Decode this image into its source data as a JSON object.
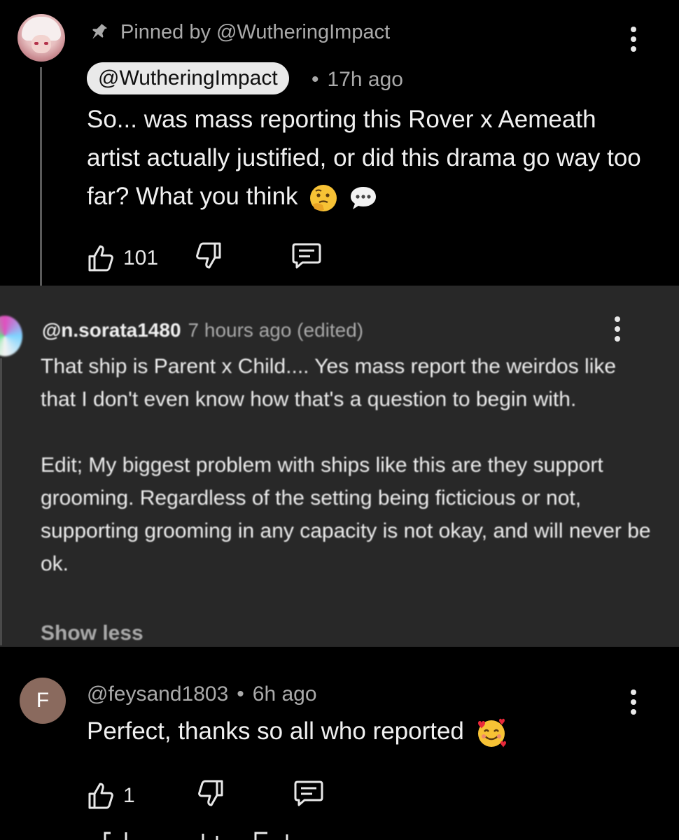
{
  "pinned_comment": {
    "pinned_label": "Pinned by @WutheringImpact",
    "author": "@WutheringImpact",
    "separator": "•",
    "time": "17h ago",
    "text": "So... was mass reporting this Rover x Aemeath artist actually justified, or did this drama go way too far? What you think",
    "emoji": [
      "thinking-face",
      "speech-bubble"
    ],
    "likes": "101"
  },
  "reply_comment": {
    "author": "@n.sorata1480",
    "meta": "7 hours ago (edited)",
    "paragraph1": "That ship is Parent x Child.... Yes mass report the weirdos like that I don't even know how that's a question to begin with.",
    "paragraph2": "Edit; My biggest problem with ships like this are they support grooming. Regardless of the setting being ficticious or not, supporting grooming in any capacity is not okay, and will never be ok.",
    "show_less": "Show less"
  },
  "third_comment": {
    "avatar_letter": "F",
    "author": "@feysand1803",
    "separator": "•",
    "time": "6h ago",
    "text": "Perfect, thanks so all who reported",
    "emoji": "smiling-face-with-hearts",
    "likes": "1"
  },
  "colors": {
    "background": "#000000",
    "reply_background": "#282828",
    "secondary_text": "#aaaaaa",
    "chip_background": "#e9e9e9",
    "avatar_f": "#8a6a5e"
  }
}
